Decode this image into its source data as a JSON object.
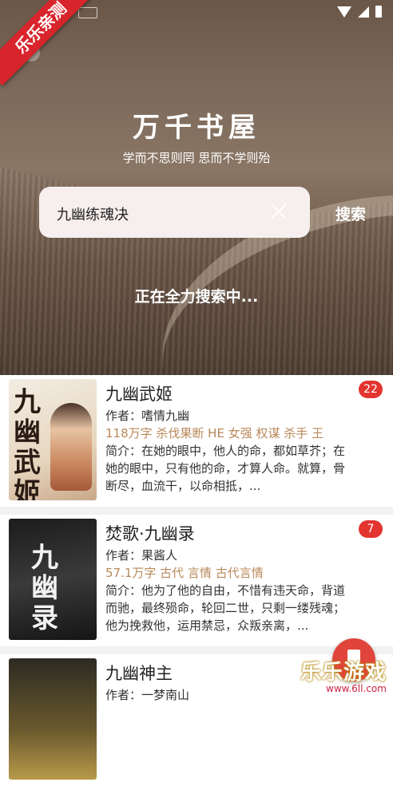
{
  "corner_badge": "乐乐亲测",
  "header": {
    "title": "万千书屋",
    "subtitle": "学而不思则罔 思而不学则殆"
  },
  "search": {
    "value": "九幽练魂决",
    "button_label": "搜索"
  },
  "status": {
    "loading_text": "正在全力搜索中..."
  },
  "results": [
    {
      "title": "九幽武姬",
      "badge": "22",
      "author": "作者：嗜情九幽",
      "meta": "118万字 杀伐果断 HE 女强 权谋 杀手 王",
      "intro": "简介：在她的眼中，他人的命，都如草芥；在她的眼中，只有他的命，才算人命。就算，骨断尽，血流干，以命相抵，...",
      "cover_text": "九幽武姬"
    },
    {
      "title": "焚歌·九幽录",
      "badge": "7",
      "author": "作者：果酱人",
      "meta": "57.1万字 古代 言情 古代言情",
      "intro": "简介：他为了他的自由，不惜有违天命，背道而驰，最终殒命，轮回二世，只剩一缕残魂；他为挽救他，运用禁忌，众叛亲离，...",
      "cover_text": "九幽录"
    },
    {
      "title": "九幽神主",
      "author": "作者：一梦南山",
      "cover_text": ""
    }
  ],
  "watermark": {
    "main": "乐乐游戏",
    "url": "www.6ll.com"
  }
}
